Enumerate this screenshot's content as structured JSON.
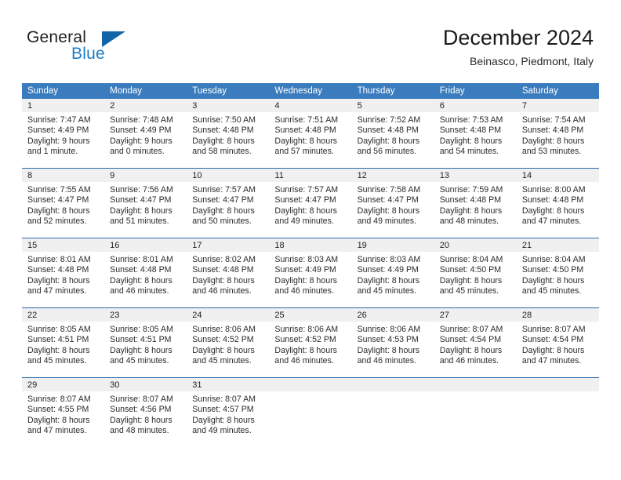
{
  "brand": {
    "name_part1": "General",
    "name_part2": "Blue",
    "triangle_color": "#1264a8",
    "blue_color": "#1b7cc4"
  },
  "header": {
    "title": "December 2024",
    "subtitle": "Beinasco, Piedmont, Italy"
  },
  "theme": {
    "header_blue": "#3a7cbe",
    "row_border_blue": "#2a6aae",
    "daynum_band": "#f0f0f0"
  },
  "weekdays": [
    "Sunday",
    "Monday",
    "Tuesday",
    "Wednesday",
    "Thursday",
    "Friday",
    "Saturday"
  ],
  "weeks": [
    [
      {
        "day": "1",
        "sunrise": "Sunrise: 7:47 AM",
        "sunset": "Sunset: 4:49 PM",
        "daylight1": "Daylight: 9 hours",
        "daylight2": "and 1 minute."
      },
      {
        "day": "2",
        "sunrise": "Sunrise: 7:48 AM",
        "sunset": "Sunset: 4:49 PM",
        "daylight1": "Daylight: 9 hours",
        "daylight2": "and 0 minutes."
      },
      {
        "day": "3",
        "sunrise": "Sunrise: 7:50 AM",
        "sunset": "Sunset: 4:48 PM",
        "daylight1": "Daylight: 8 hours",
        "daylight2": "and 58 minutes."
      },
      {
        "day": "4",
        "sunrise": "Sunrise: 7:51 AM",
        "sunset": "Sunset: 4:48 PM",
        "daylight1": "Daylight: 8 hours",
        "daylight2": "and 57 minutes."
      },
      {
        "day": "5",
        "sunrise": "Sunrise: 7:52 AM",
        "sunset": "Sunset: 4:48 PM",
        "daylight1": "Daylight: 8 hours",
        "daylight2": "and 56 minutes."
      },
      {
        "day": "6",
        "sunrise": "Sunrise: 7:53 AM",
        "sunset": "Sunset: 4:48 PM",
        "daylight1": "Daylight: 8 hours",
        "daylight2": "and 54 minutes."
      },
      {
        "day": "7",
        "sunrise": "Sunrise: 7:54 AM",
        "sunset": "Sunset: 4:48 PM",
        "daylight1": "Daylight: 8 hours",
        "daylight2": "and 53 minutes."
      }
    ],
    [
      {
        "day": "8",
        "sunrise": "Sunrise: 7:55 AM",
        "sunset": "Sunset: 4:47 PM",
        "daylight1": "Daylight: 8 hours",
        "daylight2": "and 52 minutes."
      },
      {
        "day": "9",
        "sunrise": "Sunrise: 7:56 AM",
        "sunset": "Sunset: 4:47 PM",
        "daylight1": "Daylight: 8 hours",
        "daylight2": "and 51 minutes."
      },
      {
        "day": "10",
        "sunrise": "Sunrise: 7:57 AM",
        "sunset": "Sunset: 4:47 PM",
        "daylight1": "Daylight: 8 hours",
        "daylight2": "and 50 minutes."
      },
      {
        "day": "11",
        "sunrise": "Sunrise: 7:57 AM",
        "sunset": "Sunset: 4:47 PM",
        "daylight1": "Daylight: 8 hours",
        "daylight2": "and 49 minutes."
      },
      {
        "day": "12",
        "sunrise": "Sunrise: 7:58 AM",
        "sunset": "Sunset: 4:47 PM",
        "daylight1": "Daylight: 8 hours",
        "daylight2": "and 49 minutes."
      },
      {
        "day": "13",
        "sunrise": "Sunrise: 7:59 AM",
        "sunset": "Sunset: 4:48 PM",
        "daylight1": "Daylight: 8 hours",
        "daylight2": "and 48 minutes."
      },
      {
        "day": "14",
        "sunrise": "Sunrise: 8:00 AM",
        "sunset": "Sunset: 4:48 PM",
        "daylight1": "Daylight: 8 hours",
        "daylight2": "and 47 minutes."
      }
    ],
    [
      {
        "day": "15",
        "sunrise": "Sunrise: 8:01 AM",
        "sunset": "Sunset: 4:48 PM",
        "daylight1": "Daylight: 8 hours",
        "daylight2": "and 47 minutes."
      },
      {
        "day": "16",
        "sunrise": "Sunrise: 8:01 AM",
        "sunset": "Sunset: 4:48 PM",
        "daylight1": "Daylight: 8 hours",
        "daylight2": "and 46 minutes."
      },
      {
        "day": "17",
        "sunrise": "Sunrise: 8:02 AM",
        "sunset": "Sunset: 4:48 PM",
        "daylight1": "Daylight: 8 hours",
        "daylight2": "and 46 minutes."
      },
      {
        "day": "18",
        "sunrise": "Sunrise: 8:03 AM",
        "sunset": "Sunset: 4:49 PM",
        "daylight1": "Daylight: 8 hours",
        "daylight2": "and 46 minutes."
      },
      {
        "day": "19",
        "sunrise": "Sunrise: 8:03 AM",
        "sunset": "Sunset: 4:49 PM",
        "daylight1": "Daylight: 8 hours",
        "daylight2": "and 45 minutes."
      },
      {
        "day": "20",
        "sunrise": "Sunrise: 8:04 AM",
        "sunset": "Sunset: 4:50 PM",
        "daylight1": "Daylight: 8 hours",
        "daylight2": "and 45 minutes."
      },
      {
        "day": "21",
        "sunrise": "Sunrise: 8:04 AM",
        "sunset": "Sunset: 4:50 PM",
        "daylight1": "Daylight: 8 hours",
        "daylight2": "and 45 minutes."
      }
    ],
    [
      {
        "day": "22",
        "sunrise": "Sunrise: 8:05 AM",
        "sunset": "Sunset: 4:51 PM",
        "daylight1": "Daylight: 8 hours",
        "daylight2": "and 45 minutes."
      },
      {
        "day": "23",
        "sunrise": "Sunrise: 8:05 AM",
        "sunset": "Sunset: 4:51 PM",
        "daylight1": "Daylight: 8 hours",
        "daylight2": "and 45 minutes."
      },
      {
        "day": "24",
        "sunrise": "Sunrise: 8:06 AM",
        "sunset": "Sunset: 4:52 PM",
        "daylight1": "Daylight: 8 hours",
        "daylight2": "and 45 minutes."
      },
      {
        "day": "25",
        "sunrise": "Sunrise: 8:06 AM",
        "sunset": "Sunset: 4:52 PM",
        "daylight1": "Daylight: 8 hours",
        "daylight2": "and 46 minutes."
      },
      {
        "day": "26",
        "sunrise": "Sunrise: 8:06 AM",
        "sunset": "Sunset: 4:53 PM",
        "daylight1": "Daylight: 8 hours",
        "daylight2": "and 46 minutes."
      },
      {
        "day": "27",
        "sunrise": "Sunrise: 8:07 AM",
        "sunset": "Sunset: 4:54 PM",
        "daylight1": "Daylight: 8 hours",
        "daylight2": "and 46 minutes."
      },
      {
        "day": "28",
        "sunrise": "Sunrise: 8:07 AM",
        "sunset": "Sunset: 4:54 PM",
        "daylight1": "Daylight: 8 hours",
        "daylight2": "and 47 minutes."
      }
    ],
    [
      {
        "day": "29",
        "sunrise": "Sunrise: 8:07 AM",
        "sunset": "Sunset: 4:55 PM",
        "daylight1": "Daylight: 8 hours",
        "daylight2": "and 47 minutes."
      },
      {
        "day": "30",
        "sunrise": "Sunrise: 8:07 AM",
        "sunset": "Sunset: 4:56 PM",
        "daylight1": "Daylight: 8 hours",
        "daylight2": "and 48 minutes."
      },
      {
        "day": "31",
        "sunrise": "Sunrise: 8:07 AM",
        "sunset": "Sunset: 4:57 PM",
        "daylight1": "Daylight: 8 hours",
        "daylight2": "and 49 minutes."
      },
      {
        "day": "",
        "sunrise": "",
        "sunset": "",
        "daylight1": "",
        "daylight2": ""
      },
      {
        "day": "",
        "sunrise": "",
        "sunset": "",
        "daylight1": "",
        "daylight2": ""
      },
      {
        "day": "",
        "sunrise": "",
        "sunset": "",
        "daylight1": "",
        "daylight2": ""
      },
      {
        "day": "",
        "sunrise": "",
        "sunset": "",
        "daylight1": "",
        "daylight2": ""
      }
    ]
  ]
}
